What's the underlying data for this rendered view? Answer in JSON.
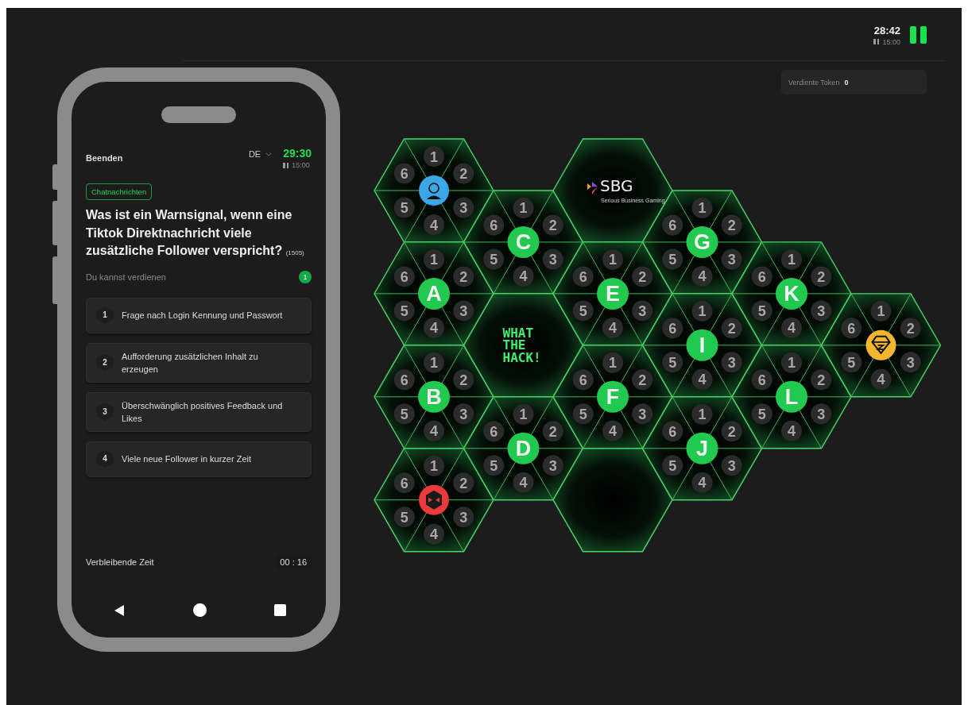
{
  "header": {
    "timer": "28:42",
    "pause_time": "15:00"
  },
  "tokens": {
    "label": "Verdiente Token",
    "value": "0"
  },
  "phone": {
    "end_label": "Beenden",
    "language": "DE",
    "timer": "29:30",
    "pause_time": "15:00",
    "category": "Chatnachrichten",
    "question": "Was ist ein Warnsignal, wenn eine Tiktok Direktnachricht viele zusätzliche Follower verspricht?",
    "question_id": "(1505)",
    "earn_label": "Du kannst verdienen",
    "earn_value": "1",
    "answers": [
      {
        "number": "1",
        "text": "Frage nach Login Kennung und Passwort"
      },
      {
        "number": "2",
        "text": "Aufforderung zusätzlichen Inhalt zu erzeugen"
      },
      {
        "number": "3",
        "text": "Überschwänglich positives Feedback und Likes"
      },
      {
        "number": "4",
        "text": "Viele neue Follower in kurzer Zeit"
      }
    ],
    "remaining_label": "Verbleibende Zeit",
    "remaining_time": "00 : 16"
  },
  "board": {
    "tiles": [
      {
        "kind": "avatar",
        "color": "#3aa8e8",
        "slots": [
          "1",
          "2",
          "3",
          "4",
          "5",
          "6"
        ]
      },
      {
        "kind": "letter",
        "letter": "A",
        "slots": [
          "1",
          "2",
          "3",
          "4",
          "5",
          "6"
        ]
      },
      {
        "kind": "letter",
        "letter": "B",
        "slots": [
          "1",
          "2",
          "3",
          "4",
          "5",
          "6"
        ]
      },
      {
        "kind": "mask",
        "color": "#ea3a3a",
        "slots": [
          "1",
          "2",
          "3",
          "4",
          "5",
          "6"
        ]
      },
      {
        "kind": "letter",
        "letter": "C",
        "slots": [
          "1",
          "2",
          "3",
          "4",
          "5",
          "6"
        ]
      },
      {
        "kind": "brand",
        "lines": [
          "WHAT",
          "THE",
          "HACK!"
        ]
      },
      {
        "kind": "letter",
        "letter": "D",
        "slots": [
          "1",
          "2",
          "3",
          "4",
          "5",
          "6"
        ]
      },
      {
        "kind": "logo",
        "name": "SBG",
        "tagline": "Serious Business Gaming"
      },
      {
        "kind": "letter",
        "letter": "E",
        "slots": [
          "1",
          "2",
          "3",
          "4",
          "5",
          "6"
        ]
      },
      {
        "kind": "letter",
        "letter": "F",
        "slots": [
          "1",
          "2",
          "3",
          "4",
          "5",
          "6"
        ]
      },
      {
        "kind": "empty"
      },
      {
        "kind": "letter",
        "letter": "G",
        "slots": [
          "1",
          "2",
          "3",
          "4",
          "5",
          "6"
        ]
      },
      {
        "kind": "letter",
        "letter": "I",
        "slots": [
          "1",
          "2",
          "3",
          "4",
          "5",
          "6"
        ]
      },
      {
        "kind": "letter",
        "letter": "J",
        "slots": [
          "1",
          "2",
          "3",
          "4",
          "5",
          "6"
        ]
      },
      {
        "kind": "letter",
        "letter": "K",
        "slots": [
          "1",
          "2",
          "3",
          "4",
          "5",
          "6"
        ]
      },
      {
        "kind": "letter",
        "letter": "L",
        "slots": [
          "1",
          "2",
          "3",
          "4",
          "5",
          "6"
        ]
      },
      {
        "kind": "gem",
        "color": "#f3b62c",
        "slots": [
          "1",
          "2",
          "3",
          "4",
          "5",
          "6"
        ]
      }
    ]
  }
}
